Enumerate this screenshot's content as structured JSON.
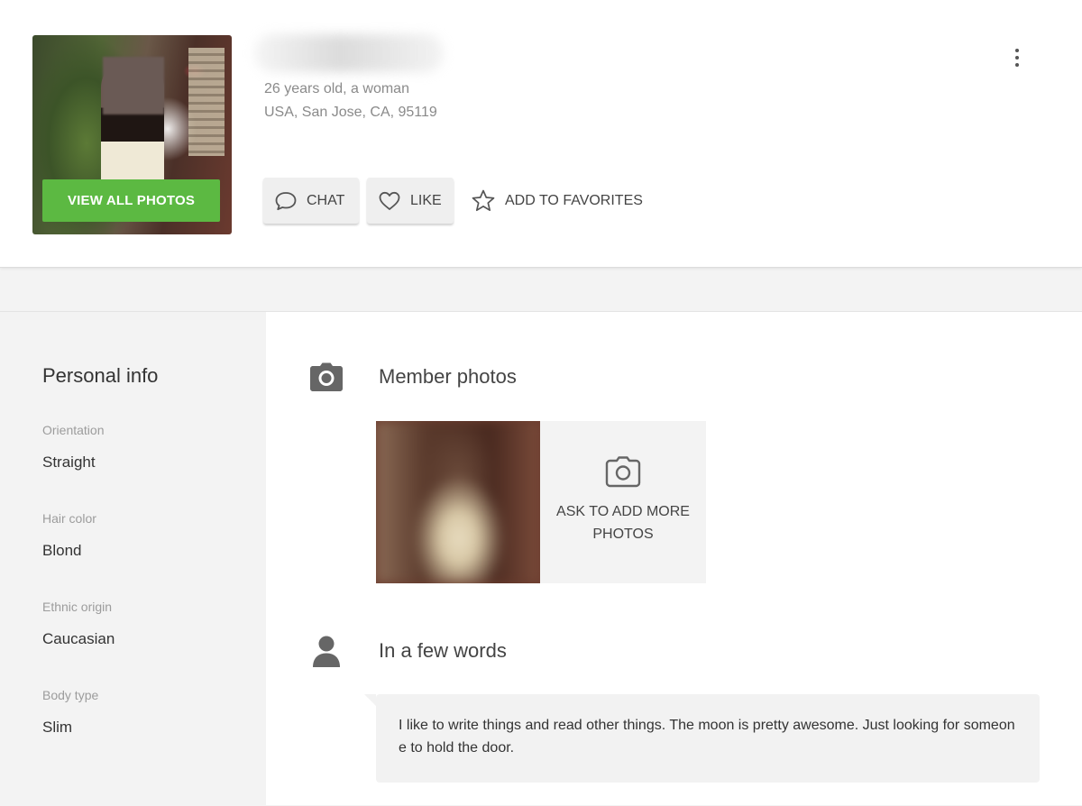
{
  "profile": {
    "age_line": "26 years old, a woman",
    "location_line": "USA, San Jose, CA, 95119",
    "view_photos_label": "VIEW ALL PHOTOS"
  },
  "actions": {
    "chat_label": "CHAT",
    "like_label": "LIKE",
    "favorites_label": "ADD TO FAVORITES"
  },
  "sidebar": {
    "title": "Personal info",
    "attributes": [
      {
        "label": "Orientation",
        "value": "Straight"
      },
      {
        "label": "Hair color",
        "value": "Blond"
      },
      {
        "label": "Ethnic origin",
        "value": "Caucasian"
      },
      {
        "label": "Body type",
        "value": "Slim"
      }
    ]
  },
  "photos_section": {
    "title": "Member photos",
    "ask_more_label": "ASK TO ADD MORE PHOTOS"
  },
  "about_section": {
    "title": "In a few words",
    "bio": "I like to write things and read other things. The moon is pretty awesome. Just looking for someone to hold the door."
  },
  "colors": {
    "accent_green": "#5cb942",
    "icon_gray": "#666666",
    "page_background": "#f3f3f3"
  },
  "icons": {
    "chat": "speech-bubble-icon",
    "like": "heart-icon",
    "favorites": "star-icon",
    "more": "vertical-dots-icon",
    "photos": "camera-icon",
    "about": "person-icon"
  }
}
